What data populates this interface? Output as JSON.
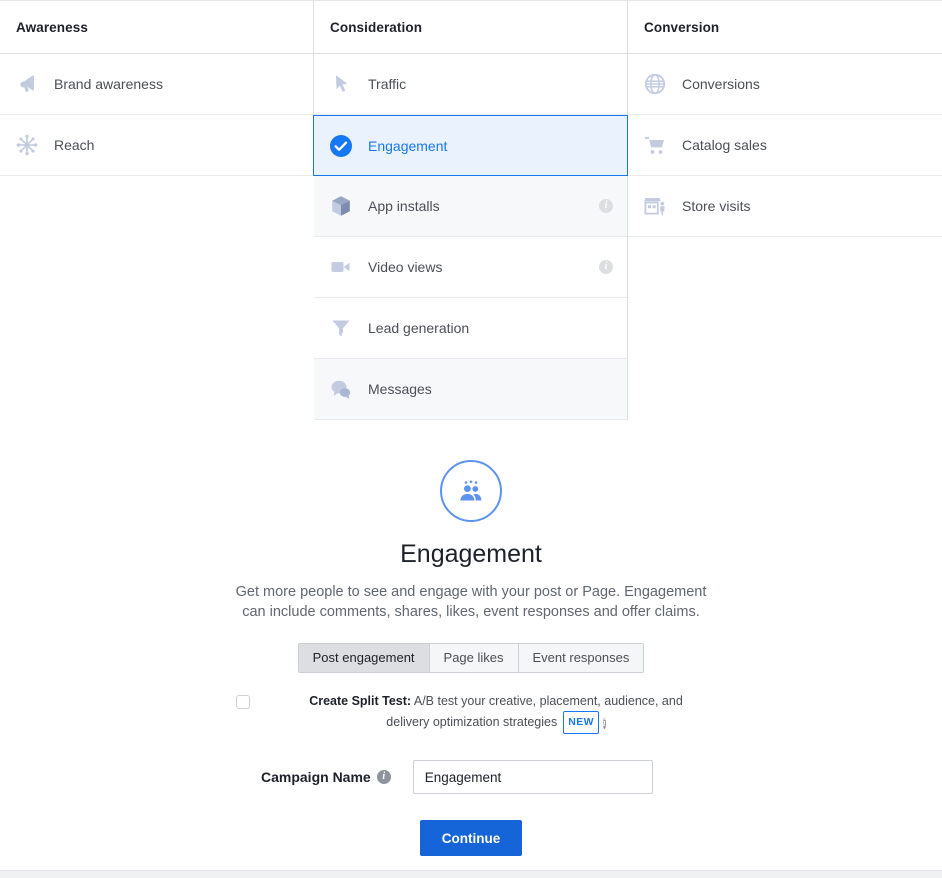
{
  "columns": [
    {
      "header": "Awareness",
      "items": [
        {
          "label": "Brand awareness",
          "icon": "megaphone-icon",
          "info": false,
          "selected": false,
          "tinted": false
        },
        {
          "label": "Reach",
          "icon": "reach-starburst-icon",
          "info": false,
          "selected": false,
          "tinted": false
        }
      ]
    },
    {
      "header": "Consideration",
      "items": [
        {
          "label": "Traffic",
          "icon": "cursor-arrow-icon",
          "info": false,
          "selected": false,
          "tinted": false
        },
        {
          "label": "Engagement",
          "icon": "check-circle-icon",
          "info": false,
          "selected": true,
          "tinted": false
        },
        {
          "label": "App installs",
          "icon": "cube-box-icon",
          "info": true,
          "selected": false,
          "tinted": true
        },
        {
          "label": "Video views",
          "icon": "video-camera-icon",
          "info": true,
          "selected": false,
          "tinted": false
        },
        {
          "label": "Lead generation",
          "icon": "funnel-icon",
          "info": false,
          "selected": false,
          "tinted": false
        },
        {
          "label": "Messages",
          "icon": "speech-bubbles-icon",
          "info": false,
          "selected": false,
          "tinted": true
        }
      ]
    },
    {
      "header": "Conversion",
      "items": [
        {
          "label": "Conversions",
          "icon": "globe-icon",
          "info": false,
          "selected": false,
          "tinted": false
        },
        {
          "label": "Catalog sales",
          "icon": "shopping-cart-icon",
          "info": false,
          "selected": false,
          "tinted": false
        },
        {
          "label": "Store visits",
          "icon": "storefront-icon",
          "info": false,
          "selected": false,
          "tinted": false
        }
      ]
    }
  ],
  "detail": {
    "icon": "people-group-icon",
    "title": "Engagement",
    "description": "Get more people to see and engage with your post or Page. Engagement can include comments, shares, likes, event responses and offer claims.",
    "tabs": [
      {
        "label": "Post engagement",
        "active": true
      },
      {
        "label": "Page likes",
        "active": false
      },
      {
        "label": "Event responses",
        "active": false
      }
    ],
    "split_test": {
      "checked": false,
      "label_bold": "Create Split Test:",
      "label_rest": "A/B test your creative, placement, audience, and delivery optimization strategies",
      "badge": "NEW"
    },
    "campaign": {
      "label": "Campaign Name",
      "value": "Engagement",
      "placeholder": "Campaign Name"
    },
    "continue_label": "Continue"
  },
  "colors": {
    "accent_blue": "#1877f2",
    "selected_bg": "#e9f2fd",
    "continue_blue": "#1565d8",
    "icon_muted": "#c2cbe0",
    "text_dark": "#1d2129",
    "text_muted": "#4b4f56"
  }
}
